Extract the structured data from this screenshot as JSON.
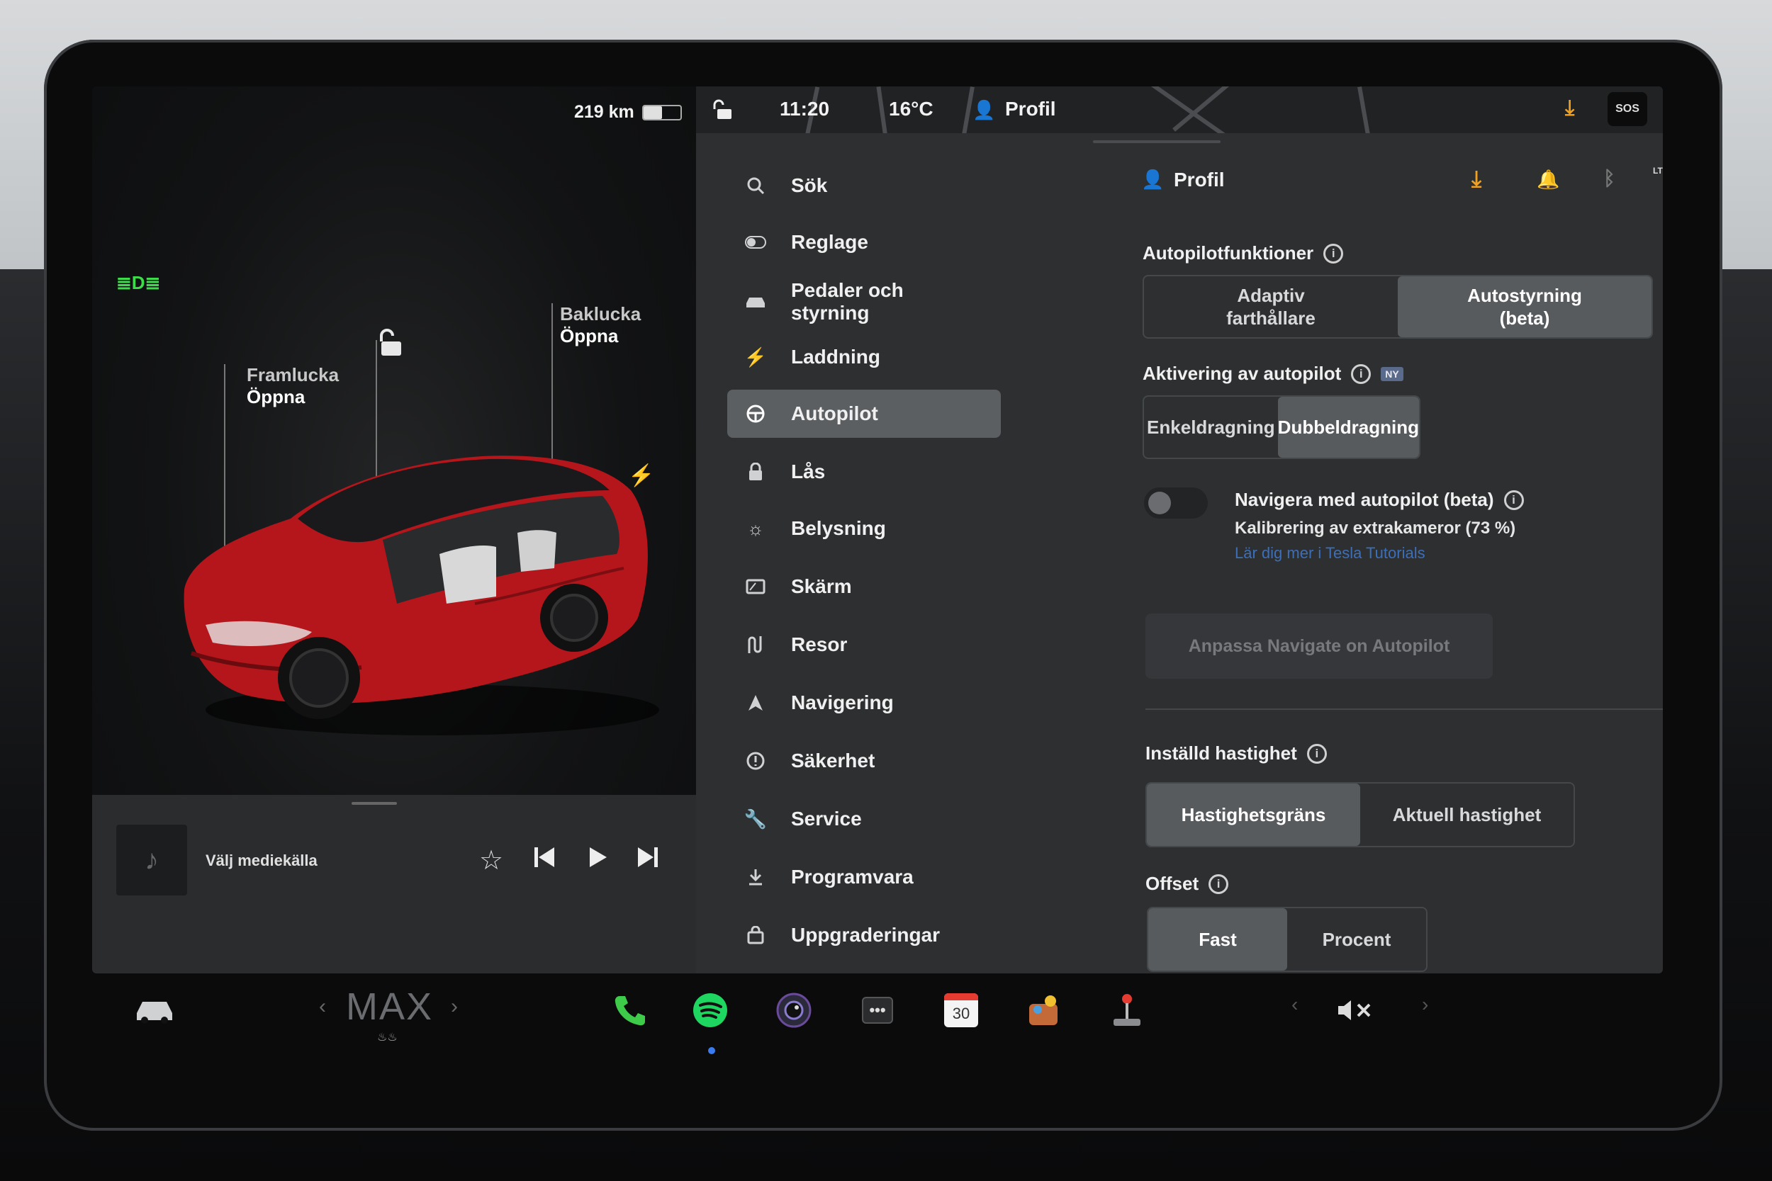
{
  "status": {
    "range": "219 km",
    "time": "11:20",
    "temp": "16°C",
    "profile": "Profil",
    "sos": "SOS"
  },
  "car": {
    "front_label": "Framlucka",
    "front_action": "Öppna",
    "rear_label": "Baklucka",
    "rear_action": "Öppna"
  },
  "media": {
    "source": "Välj mediekälla"
  },
  "menu": {
    "items": [
      {
        "label": "Sök",
        "icon": "search-icon"
      },
      {
        "label": "Reglage",
        "icon": "toggle-icon"
      },
      {
        "label": "Pedaler och styrning",
        "icon": "car-icon"
      },
      {
        "label": "Laddning",
        "icon": "bolt-icon"
      },
      {
        "label": "Autopilot",
        "icon": "steering-wheel-icon"
      },
      {
        "label": "Lås",
        "icon": "lock-icon"
      },
      {
        "label": "Belysning",
        "icon": "sun-icon"
      },
      {
        "label": "Skärm",
        "icon": "display-icon"
      },
      {
        "label": "Resor",
        "icon": "trips-icon"
      },
      {
        "label": "Navigering",
        "icon": "navigation-icon"
      },
      {
        "label": "Säkerhet",
        "icon": "safety-icon"
      },
      {
        "label": "Service",
        "icon": "wrench-icon"
      },
      {
        "label": "Programvara",
        "icon": "download-icon"
      },
      {
        "label": "Uppgraderingar",
        "icon": "bag-icon"
      }
    ]
  },
  "panel": {
    "header": "Profil",
    "lte": "LTE",
    "autopilot_features": {
      "title": "Autopilotfunktioner",
      "opt1": "Adaptiv farthållare",
      "opt2": "Autostyrning (beta)"
    },
    "activation": {
      "title": "Aktivering av autopilot",
      "badge": "NY",
      "opt1": "Enkeldragning",
      "opt2": "Dubbeldragning"
    },
    "nav_autopilot": {
      "title": "Navigera med autopilot (beta)",
      "status": "Kalibrering av extrakameror (73 %)",
      "link": "Lär dig mer i Tesla Tutorials",
      "button": "Anpassa Navigate on Autopilot"
    },
    "set_speed": {
      "title": "Inställd hastighet",
      "opt1": "Hastighetsgräns",
      "opt2": "Aktuell hastighet"
    },
    "offset": {
      "title": "Offset",
      "opt1": "Fast",
      "opt2": "Procent"
    }
  },
  "dock": {
    "climate": "MAX",
    "calendar_day": "30"
  },
  "colors": {
    "accent_orange": "#f0a020",
    "spotify_green": "#1ed760",
    "phone_green": "#3ecb4a",
    "car_red": "#c41a1f",
    "link_blue": "#3d6fb8"
  }
}
